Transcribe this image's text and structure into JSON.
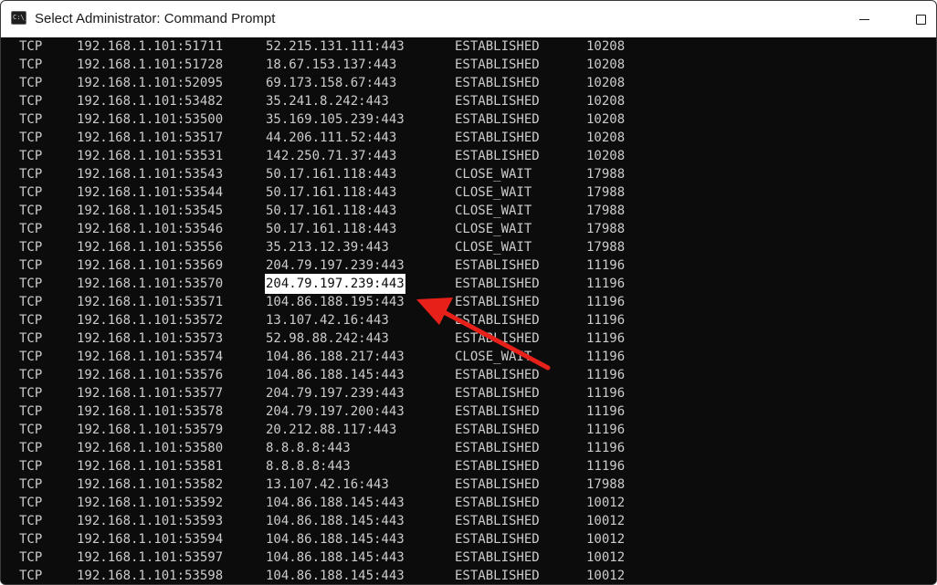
{
  "window": {
    "title": "Select Administrator: Command Prompt",
    "icon_text": "C:\\_",
    "icon": "command-prompt-icon",
    "controls": [
      "minimize-icon",
      "maximize-icon"
    ]
  },
  "console": {
    "selected_row": 13,
    "selected_column": "foreign",
    "annotation": "red arrow pointing at selected foreign address",
    "rows": [
      {
        "proto": "TCP",
        "local": "192.168.1.101:51711",
        "foreign": "52.215.131.111:443",
        "state": "ESTABLISHED",
        "pid": "10208"
      },
      {
        "proto": "TCP",
        "local": "192.168.1.101:51728",
        "foreign": "18.67.153.137:443",
        "state": "ESTABLISHED",
        "pid": "10208"
      },
      {
        "proto": "TCP",
        "local": "192.168.1.101:52095",
        "foreign": "69.173.158.67:443",
        "state": "ESTABLISHED",
        "pid": "10208"
      },
      {
        "proto": "TCP",
        "local": "192.168.1.101:53482",
        "foreign": "35.241.8.242:443",
        "state": "ESTABLISHED",
        "pid": "10208"
      },
      {
        "proto": "TCP",
        "local": "192.168.1.101:53500",
        "foreign": "35.169.105.239:443",
        "state": "ESTABLISHED",
        "pid": "10208"
      },
      {
        "proto": "TCP",
        "local": "192.168.1.101:53517",
        "foreign": "44.206.111.52:443",
        "state": "ESTABLISHED",
        "pid": "10208"
      },
      {
        "proto": "TCP",
        "local": "192.168.1.101:53531",
        "foreign": "142.250.71.37:443",
        "state": "ESTABLISHED",
        "pid": "10208"
      },
      {
        "proto": "TCP",
        "local": "192.168.1.101:53543",
        "foreign": "50.17.161.118:443",
        "state": "CLOSE_WAIT",
        "pid": "17988"
      },
      {
        "proto": "TCP",
        "local": "192.168.1.101:53544",
        "foreign": "50.17.161.118:443",
        "state": "CLOSE_WAIT",
        "pid": "17988"
      },
      {
        "proto": "TCP",
        "local": "192.168.1.101:53545",
        "foreign": "50.17.161.118:443",
        "state": "CLOSE_WAIT",
        "pid": "17988"
      },
      {
        "proto": "TCP",
        "local": "192.168.1.101:53546",
        "foreign": "50.17.161.118:443",
        "state": "CLOSE_WAIT",
        "pid": "17988"
      },
      {
        "proto": "TCP",
        "local": "192.168.1.101:53556",
        "foreign": "35.213.12.39:443",
        "state": "CLOSE_WAIT",
        "pid": "17988"
      },
      {
        "proto": "TCP",
        "local": "192.168.1.101:53569",
        "foreign": "204.79.197.239:443",
        "state": "ESTABLISHED",
        "pid": "11196"
      },
      {
        "proto": "TCP",
        "local": "192.168.1.101:53570",
        "foreign": "204.79.197.239:443",
        "state": "ESTABLISHED",
        "pid": "11196"
      },
      {
        "proto": "TCP",
        "local": "192.168.1.101:53571",
        "foreign": "104.86.188.195:443",
        "state": "ESTABLISHED",
        "pid": "11196"
      },
      {
        "proto": "TCP",
        "local": "192.168.1.101:53572",
        "foreign": "13.107.42.16:443",
        "state": "ESTABLISHED",
        "pid": "11196"
      },
      {
        "proto": "TCP",
        "local": "192.168.1.101:53573",
        "foreign": "52.98.88.242:443",
        "state": "ESTABLISHED",
        "pid": "11196"
      },
      {
        "proto": "TCP",
        "local": "192.168.1.101:53574",
        "foreign": "104.86.188.217:443",
        "state": "CLOSE_WAIT",
        "pid": "11196"
      },
      {
        "proto": "TCP",
        "local": "192.168.1.101:53576",
        "foreign": "104.86.188.145:443",
        "state": "ESTABLISHED",
        "pid": "11196"
      },
      {
        "proto": "TCP",
        "local": "192.168.1.101:53577",
        "foreign": "204.79.197.239:443",
        "state": "ESTABLISHED",
        "pid": "11196"
      },
      {
        "proto": "TCP",
        "local": "192.168.1.101:53578",
        "foreign": "204.79.197.200:443",
        "state": "ESTABLISHED",
        "pid": "11196"
      },
      {
        "proto": "TCP",
        "local": "192.168.1.101:53579",
        "foreign": "20.212.88.117:443",
        "state": "ESTABLISHED",
        "pid": "11196"
      },
      {
        "proto": "TCP",
        "local": "192.168.1.101:53580",
        "foreign": "8.8.8.8:443",
        "state": "ESTABLISHED",
        "pid": "11196"
      },
      {
        "proto": "TCP",
        "local": "192.168.1.101:53581",
        "foreign": "8.8.8.8:443",
        "state": "ESTABLISHED",
        "pid": "11196"
      },
      {
        "proto": "TCP",
        "local": "192.168.1.101:53582",
        "foreign": "13.107.42.16:443",
        "state": "ESTABLISHED",
        "pid": "17988"
      },
      {
        "proto": "TCP",
        "local": "192.168.1.101:53592",
        "foreign": "104.86.188.145:443",
        "state": "ESTABLISHED",
        "pid": "10012"
      },
      {
        "proto": "TCP",
        "local": "192.168.1.101:53593",
        "foreign": "104.86.188.145:443",
        "state": "ESTABLISHED",
        "pid": "10012"
      },
      {
        "proto": "TCP",
        "local": "192.168.1.101:53594",
        "foreign": "104.86.188.145:443",
        "state": "ESTABLISHED",
        "pid": "10012"
      },
      {
        "proto": "TCP",
        "local": "192.168.1.101:53597",
        "foreign": "104.86.188.145:443",
        "state": "ESTABLISHED",
        "pid": "10012"
      },
      {
        "proto": "TCP",
        "local": "192.168.1.101:53598",
        "foreign": "104.86.188.145:443",
        "state": "ESTABLISHED",
        "pid": "10012"
      }
    ]
  },
  "colors": {
    "console_bg": "#0c0c0c",
    "console_text": "#cccccc",
    "selection_bg": "#ffffff",
    "selection_text": "#0c0c0c",
    "arrow": "#e8201a"
  }
}
